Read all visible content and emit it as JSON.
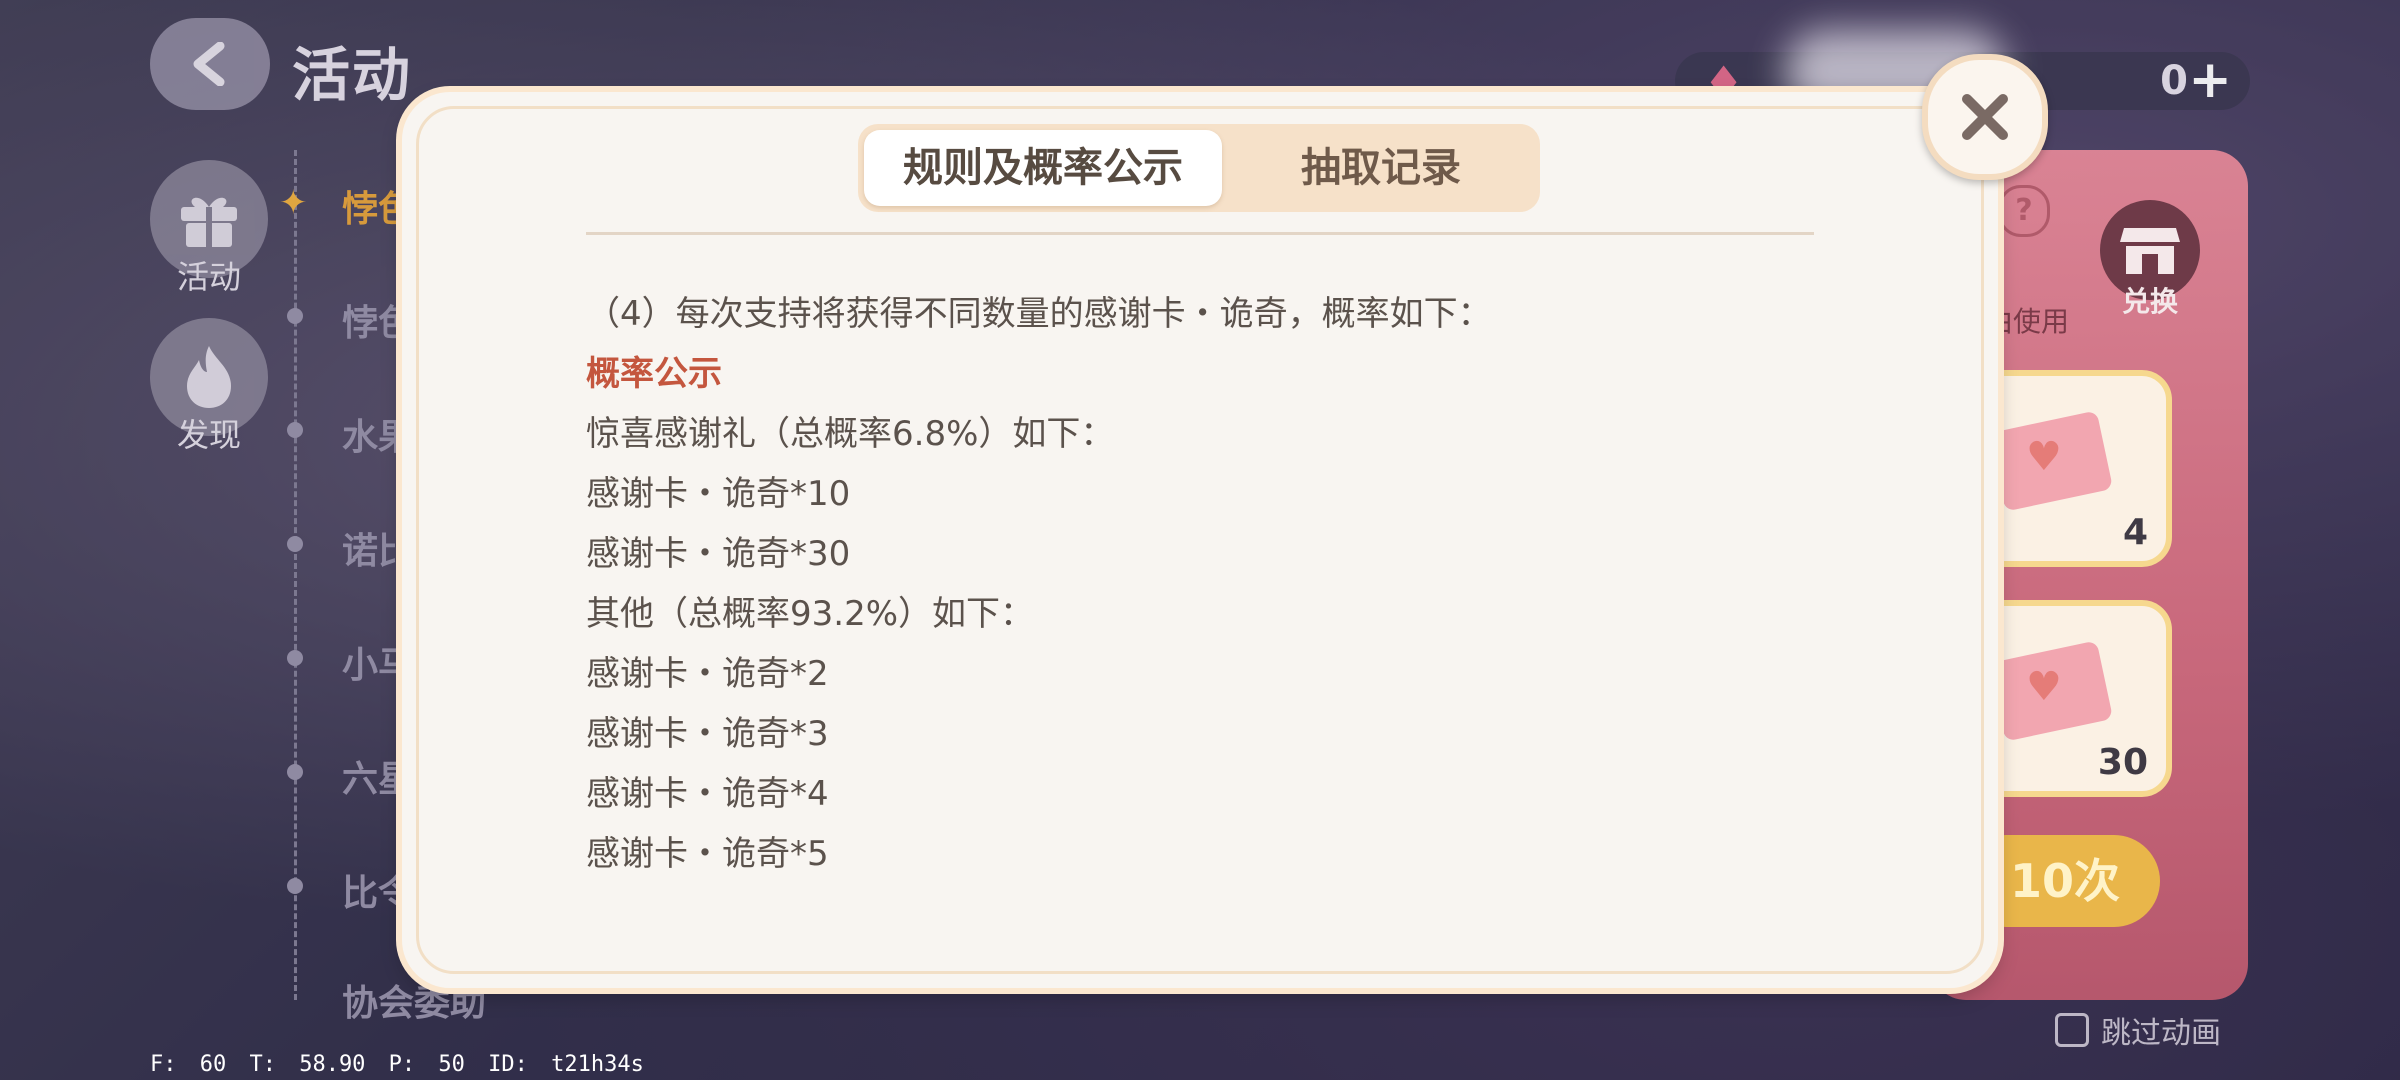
{
  "header": {
    "title": "活动"
  },
  "nav": {
    "items": [
      {
        "label": "活动"
      },
      {
        "label": "发现"
      }
    ]
  },
  "timeline": {
    "items": [
      "悖色",
      "悖色",
      "水果",
      "诺比",
      "小马",
      "六星",
      "比令",
      "协会委助"
    ]
  },
  "currency": {
    "value": "0"
  },
  "right_panel": {
    "use_label": "由使用",
    "exchange_label": "兑换",
    "cards": [
      {
        "count": "4"
      },
      {
        "count": "30"
      }
    ],
    "draw_button": "10次"
  },
  "skip_animation": "跳过动画",
  "debug": "F: 60   T: 58.90   P: 50   ID: t21h34s",
  "modal": {
    "tabs": [
      {
        "label": "规则及概率公示"
      },
      {
        "label": "抽取记录"
      }
    ],
    "lines": [
      "（4）每次支持将获得不同数量的感谢卡・诡奇，概率如下：",
      "概率公示",
      "惊喜感谢礼（总概率6.8%）如下：",
      "感谢卡・诡奇*10",
      "感谢卡・诡奇*30",
      "其他（总概率93.2%）如下：",
      "感谢卡・诡奇*2",
      "感谢卡・诡奇*3",
      "感谢卡・诡奇*4",
      "感谢卡・诡奇*5"
    ]
  },
  "colors": {
    "accent_heading": "#c4563e",
    "tab_bg": "#f6e1c9",
    "modal_bg": "#f8f5f1"
  }
}
